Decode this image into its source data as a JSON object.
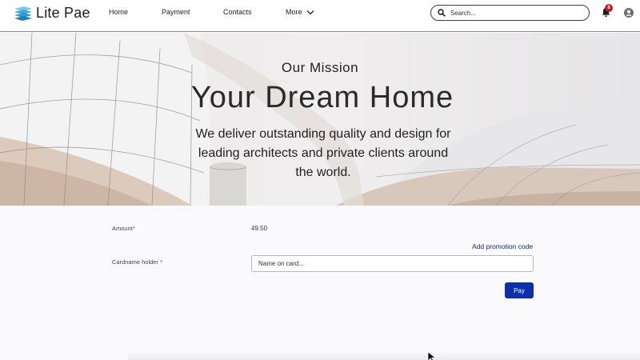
{
  "header": {
    "brand": "Lite Pae",
    "nav": [
      {
        "label": "Home"
      },
      {
        "label": "Payment"
      },
      {
        "label": "Contacts"
      },
      {
        "label": "More"
      }
    ],
    "search": {
      "placeholder": "Search...",
      "value": ""
    },
    "notifications": {
      "count": "8"
    }
  },
  "hero": {
    "subtitle": "Our Mission",
    "title": "Your Dream Home",
    "description": "We deliver outstanding quality and design for leading architects and private clients around the world."
  },
  "form": {
    "amount": {
      "label": "Amount",
      "required_mark": "*",
      "value": "49.50"
    },
    "promo_link": "Add promotion code",
    "cardholder": {
      "label": "Cardname holder",
      "required_mark": "*",
      "placeholder": "Name on card...",
      "value": ""
    },
    "pay_label": "Pay"
  },
  "colors": {
    "accent": "#0b2fae",
    "link": "#0b2a8a",
    "badge": "#c2182b",
    "logo": "#2f9bd6"
  },
  "icons": [
    "logo-icon",
    "chevron-down-icon",
    "search-icon",
    "bell-icon",
    "user-icon",
    "cursor-icon"
  ]
}
